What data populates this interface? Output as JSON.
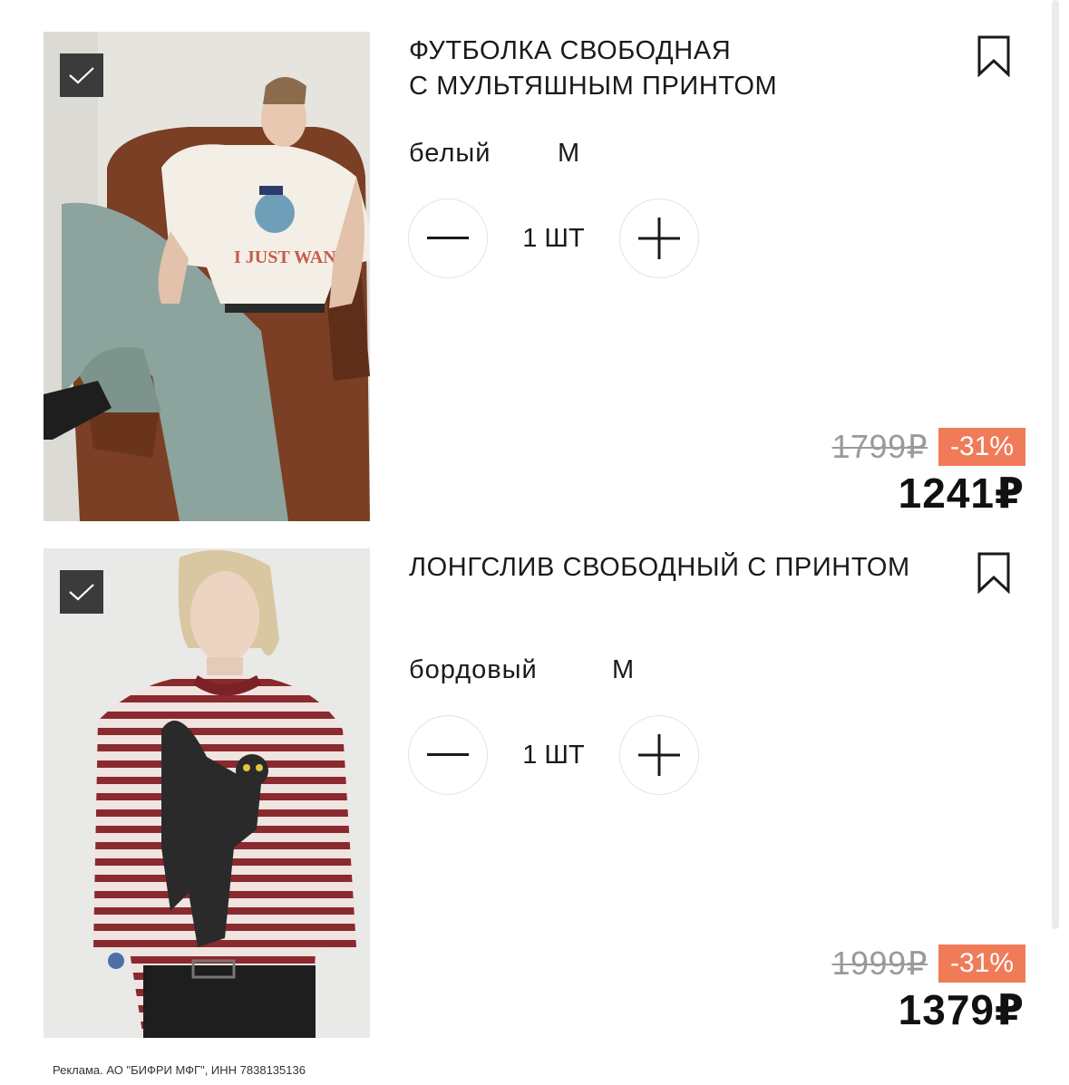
{
  "colors": {
    "discount_badge": "#f07b58",
    "checkbox": "#3b3b3b",
    "old_price": "#9a9a9a"
  },
  "products": [
    {
      "title_line1": "ФУТБОЛКА СВОБОДНАЯ",
      "title_line2": "С МУЛЬТЯШНЫМ ПРИНТОМ",
      "color": "белый",
      "size": "M",
      "quantity": "1 ШТ",
      "old_price": "1799₽",
      "discount": "-31%",
      "price": "1241₽",
      "selected": true,
      "icons": [
        "checkmark-icon",
        "bookmark-icon",
        "minus-icon",
        "plus-icon"
      ]
    },
    {
      "title_line1": "ЛОНГСЛИВ СВОБОДНЫЙ С ПРИНТОМ",
      "title_line2": "",
      "color": "бордовый",
      "size": "M",
      "quantity": "1 ШТ",
      "old_price": "1999₽",
      "discount": "-31%",
      "price": "1379₽",
      "selected": true,
      "icons": [
        "checkmark-icon",
        "bookmark-icon",
        "minus-icon",
        "plus-icon"
      ]
    }
  ],
  "footer": {
    "ad_text": "Реклама. АО \"БИФРИ МФГ\", ИНН 7838135136"
  }
}
